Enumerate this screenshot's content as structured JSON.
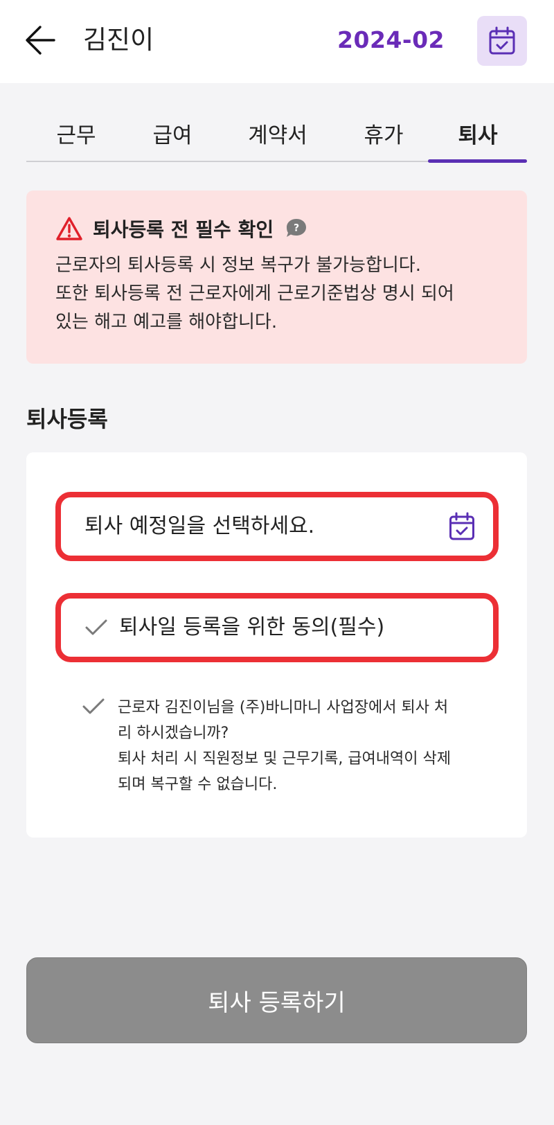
{
  "header": {
    "title": "김진이",
    "month": "2024-02",
    "back_icon": "arrow-left-icon",
    "calendar_icon": "calendar-check-icon"
  },
  "tabs": [
    {
      "label": "근무",
      "active": false
    },
    {
      "label": "급여",
      "active": false
    },
    {
      "label": "계약서",
      "active": false
    },
    {
      "label": "휴가",
      "active": false
    },
    {
      "label": "퇴사",
      "active": true
    }
  ],
  "notice": {
    "title": "퇴사등록 전 필수 확인",
    "warning_icon": "warning-triangle-icon",
    "help_icon": "help-bubble-icon",
    "lines": [
      "근로자의 퇴사등록 시 정보 복구가 불가능합니다.",
      "또한 퇴사등록 전 근로자에게 근로기준법상 명시 되어",
      "있는 해고 예고를 해야합니다."
    ]
  },
  "section": {
    "title": "퇴사등록"
  },
  "form": {
    "date_placeholder": "퇴사 예정일을 선택하세요.",
    "agree_label": "퇴사일 등록을 위한 동의(필수)",
    "info_lines": [
      "근로자 김진이님을 (주)바니마니 사업장에서 퇴사 처",
      "리 하시겠습니까?",
      "퇴사 처리 시 직원정보 및 근무기록, 급여내역이 삭제",
      "되며 복구할 수 없습니다."
    ]
  },
  "submit_label": "퇴사 등록하기",
  "colors": {
    "accent": "#5a2fb4",
    "month_text": "#6a2bb8",
    "notice_bg": "#fde2e2",
    "warning": "#e0202a",
    "highlight_border": "#ec2f35",
    "submit_bg": "#8c8c8c"
  }
}
